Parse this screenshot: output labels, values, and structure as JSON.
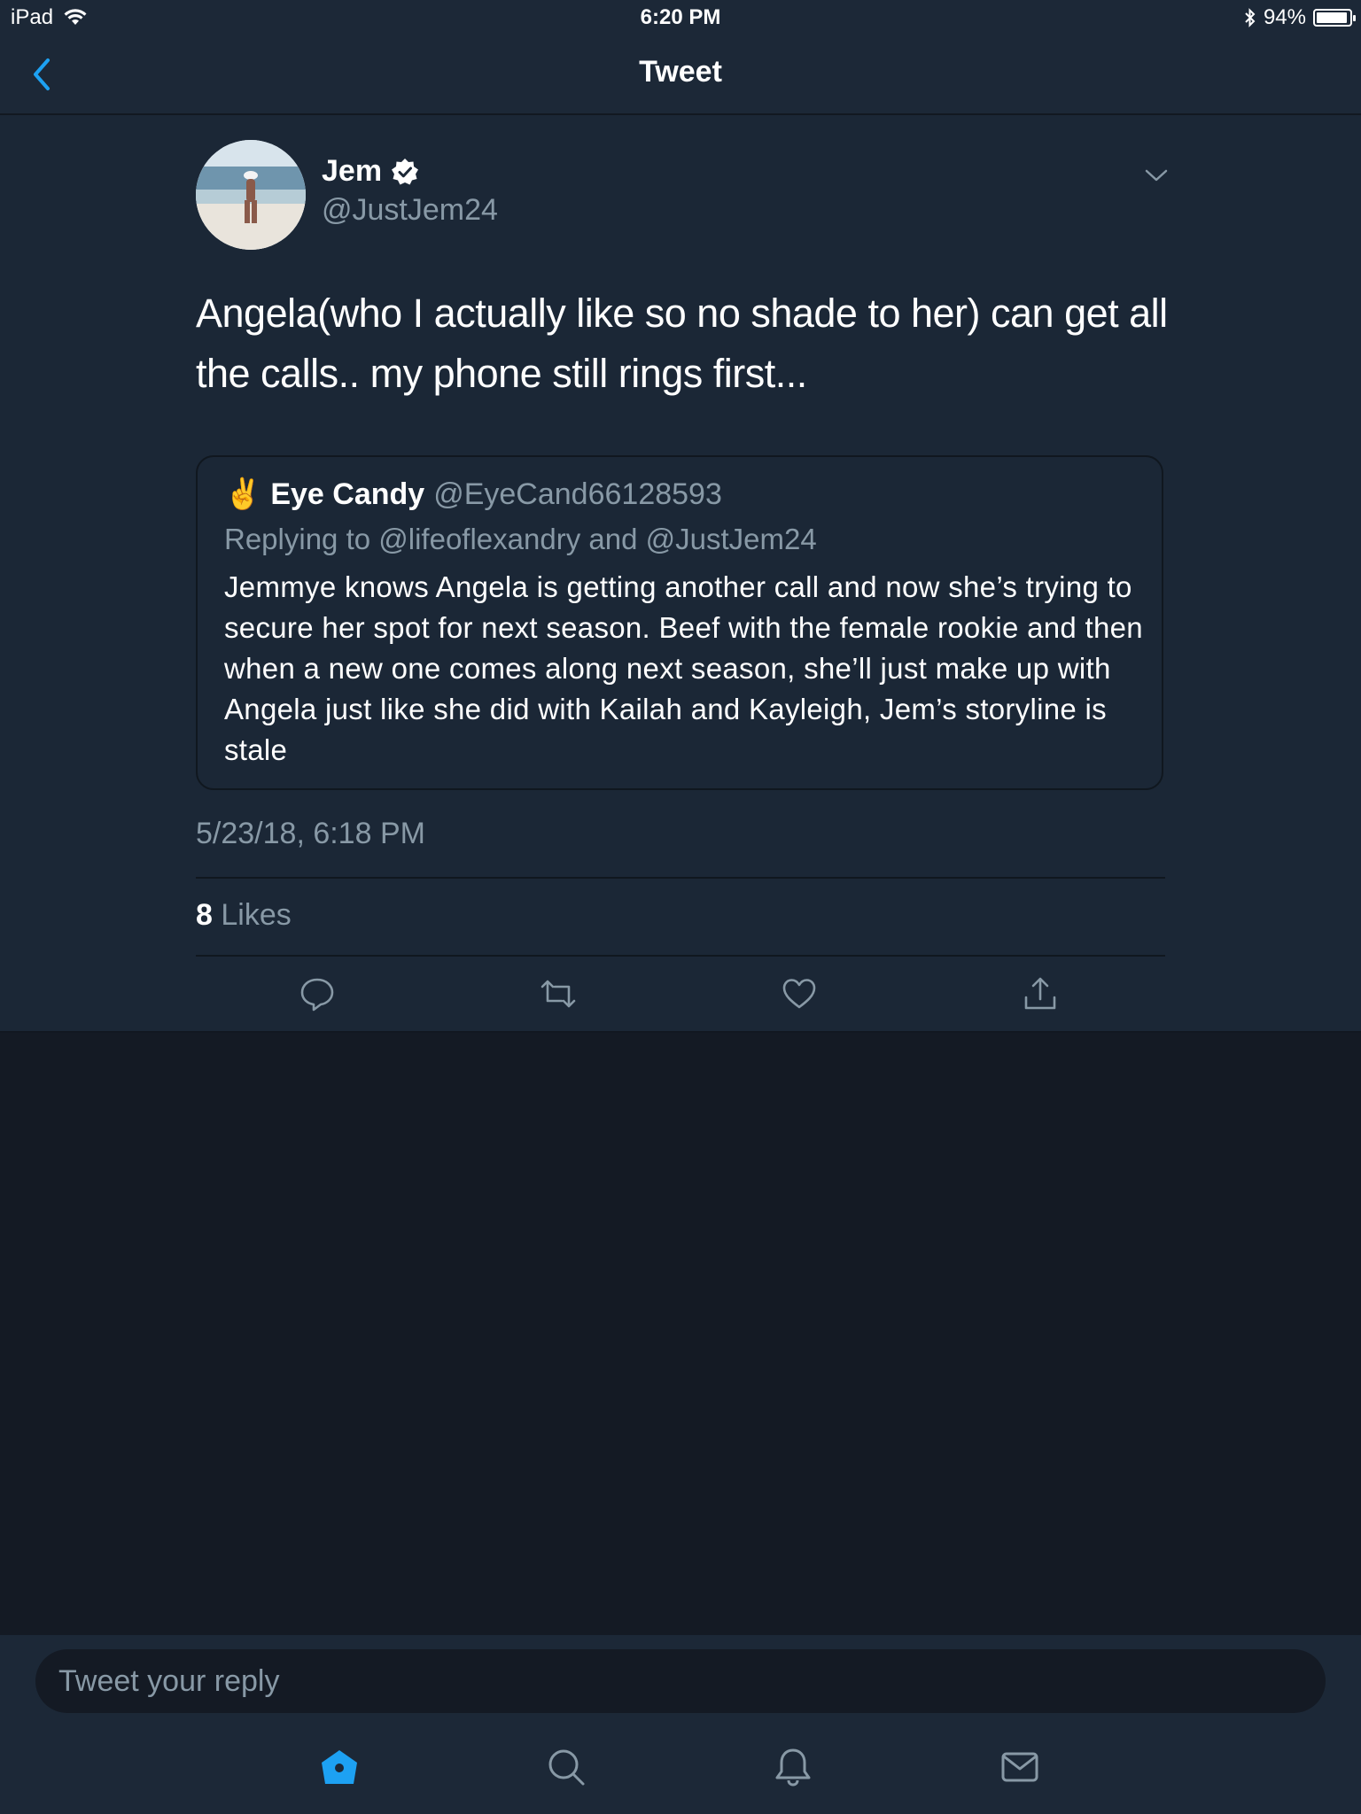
{
  "status_bar": {
    "device": "iPad",
    "time": "6:20 PM",
    "battery": "94%",
    "battery_level": 0.94,
    "icons": [
      "wifi-icon",
      "bluetooth-icon",
      "battery-icon"
    ]
  },
  "nav": {
    "title": "Tweet",
    "back_icon": "chevron-left-icon"
  },
  "tweet": {
    "author_name": "Jem",
    "verified": true,
    "author_handle": "@JustJem24",
    "text": "Angela(who I actually like so no shade to her) can get all the calls.. my phone still rings first...",
    "quoted": {
      "emoji": "✌️",
      "name": "Eye  Candy",
      "handle": "@EyeCand66128593",
      "replying_to": "Replying to @lifeoflexandry and @JustJem24",
      "text": "Jemmye knows Angela is getting another call and now she’s trying to secure her spot for next season. Beef with the female rookie and then when a new one comes along next season, she’ll just make up with Angela just like she did with Kailah and Kayleigh, Jem’s storyline is stale"
    },
    "timestamp": "5/23/18, 6:18 PM",
    "likes_count": "8",
    "likes_label": "Likes",
    "actions": [
      "reply-icon",
      "retweet-icon",
      "like-icon",
      "share-icon"
    ]
  },
  "reply": {
    "placeholder": "Tweet your reply"
  },
  "tab_bar": {
    "items": [
      "home-icon",
      "search-icon",
      "notifications-icon",
      "messages-icon"
    ],
    "active": "home-icon"
  },
  "colors": {
    "background": "#141a24",
    "panel": "#1b2736",
    "bar": "#1c2837",
    "accent": "#1da1f2",
    "secondary_text": "#8899a6"
  }
}
